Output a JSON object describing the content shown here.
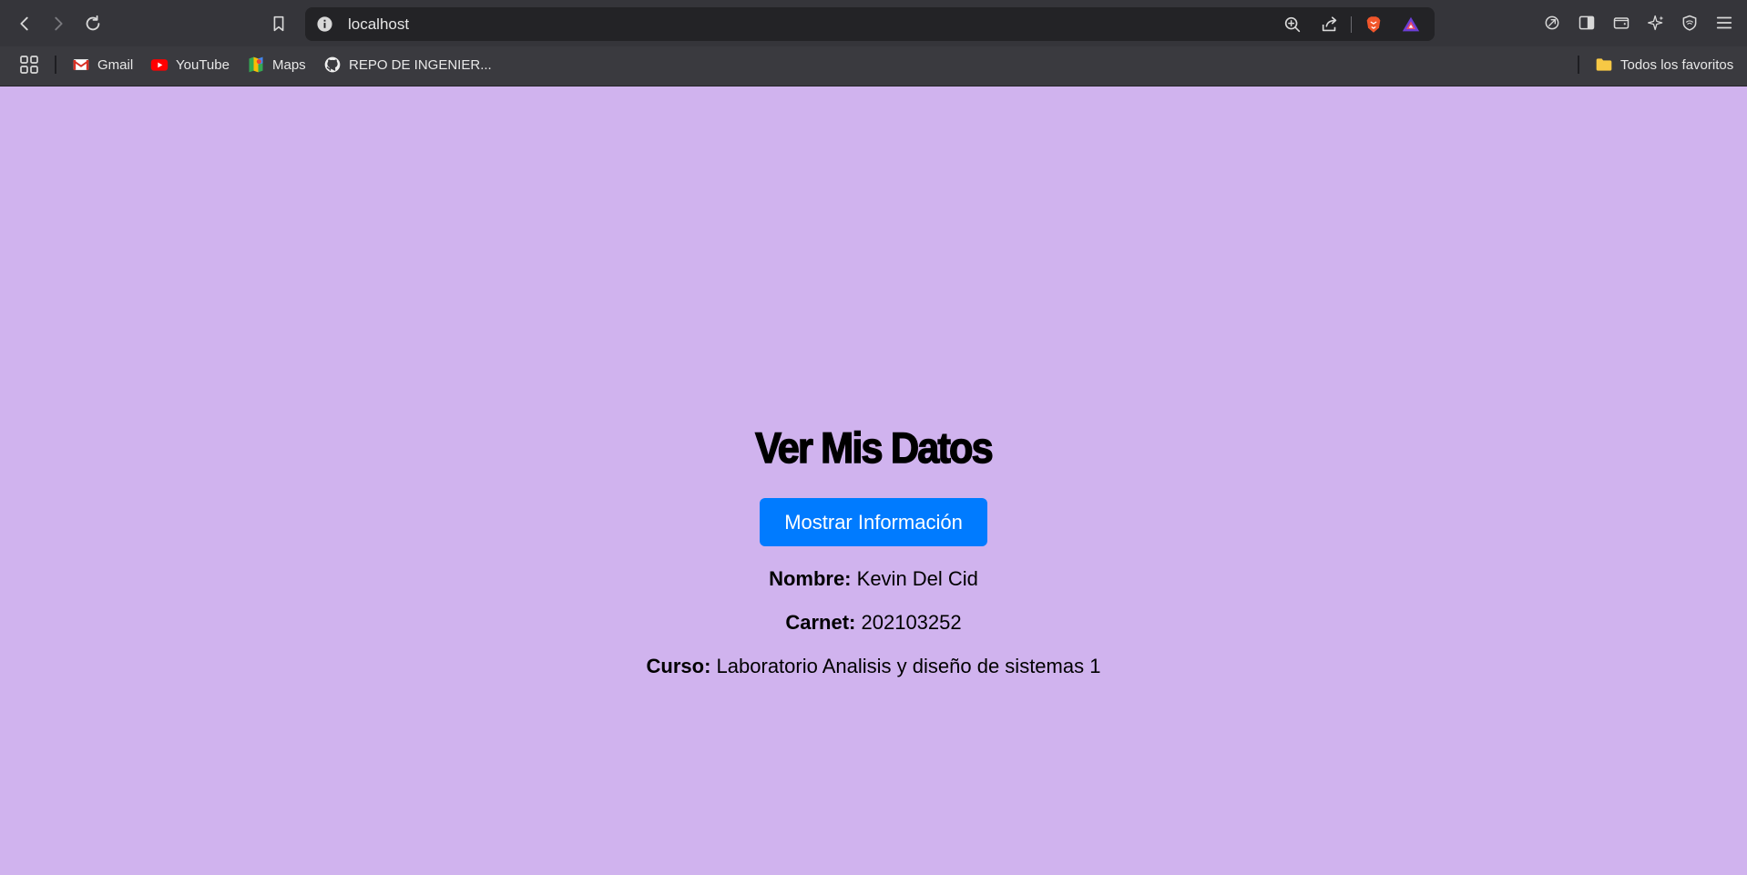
{
  "browser": {
    "url": "localhost",
    "bookmarks": [
      {
        "label": "Gmail",
        "icon": "gmail-icon"
      },
      {
        "label": "YouTube",
        "icon": "youtube-icon"
      },
      {
        "label": "Maps",
        "icon": "maps-icon"
      },
      {
        "label": "REPO DE INGENIER...",
        "icon": "github-icon"
      }
    ],
    "all_bookmarks_label": "Todos los favoritos"
  },
  "page": {
    "background_color": "#d0b3ee",
    "title": "Ver Mis Datos",
    "show_button_label": "Mostrar Información",
    "button_color": "#007bff",
    "info": {
      "nombre_label": "Nombre:",
      "nombre_value": "Kevin Del Cid",
      "carnet_label": "Carnet:",
      "carnet_value": "202103252",
      "curso_label": "Curso:",
      "curso_value": "Laboratorio Analisis y diseño de sistemas 1"
    }
  }
}
